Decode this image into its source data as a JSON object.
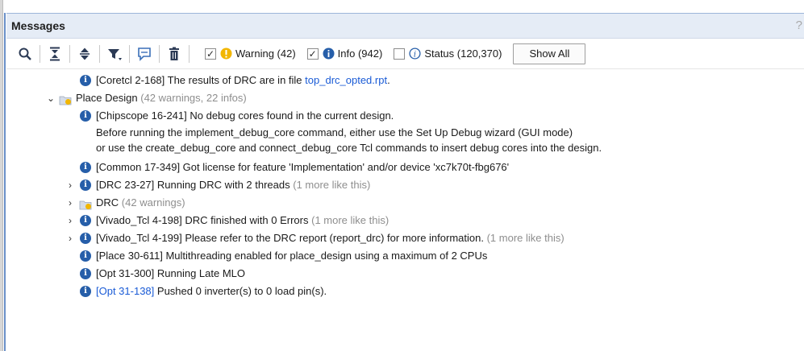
{
  "panel": {
    "title": "Messages",
    "help": "?"
  },
  "toolbar": {
    "filters": [
      {
        "label": "Warning (42)",
        "checked": true
      },
      {
        "label": "Info (942)",
        "checked": true
      },
      {
        "label": "Status (120,370)",
        "checked": false
      }
    ],
    "show_all": "Show All"
  },
  "messages": [
    {
      "text": "[Coretcl 2-168] The results of DRC are in file ",
      "link": "top_drc_opted.rpt",
      "after": "."
    },
    {
      "title": "Place Design",
      "counts": "(42 warnings, 22 infos)"
    },
    {
      "lines": [
        "[Chipscope 16-241] No debug cores found in the current design.",
        "Before running the implement_debug_core command, either use the Set Up Debug wizard (GUI mode)",
        "or use the create_debug_core and connect_debug_core Tcl commands to insert debug cores into the design."
      ]
    },
    {
      "text": "[Common 17-349] Got license for feature 'Implementation' and/or device 'xc7k70t-fbg676'"
    },
    {
      "text": "[DRC 23-27] Running DRC with 2 threads",
      "more": "(1 more like this)"
    },
    {
      "title": "DRC",
      "counts": "(42 warnings)"
    },
    {
      "text": "[Vivado_Tcl 4-198] DRC finished with 0 Errors",
      "more": "(1 more like this)"
    },
    {
      "text": "[Vivado_Tcl 4-199] Please refer to the DRC report (report_drc) for more information.",
      "more": "(1 more like this)"
    },
    {
      "text": "[Place 30-611] Multithreading enabled for place_design using a maximum of 2 CPUs"
    },
    {
      "text": "[Opt 31-300] Running Late MLO"
    },
    {
      "link": "[Opt 31-138]",
      "text": " Pushed 0 inverter(s) to 0 load pin(s)."
    }
  ],
  "colors": {
    "header_bg": "#e5ecf6",
    "info_icon": "#265ea9",
    "warning_icon": "#f2b600",
    "link": "#1a5bd6",
    "muted": "#8e8e8e"
  }
}
